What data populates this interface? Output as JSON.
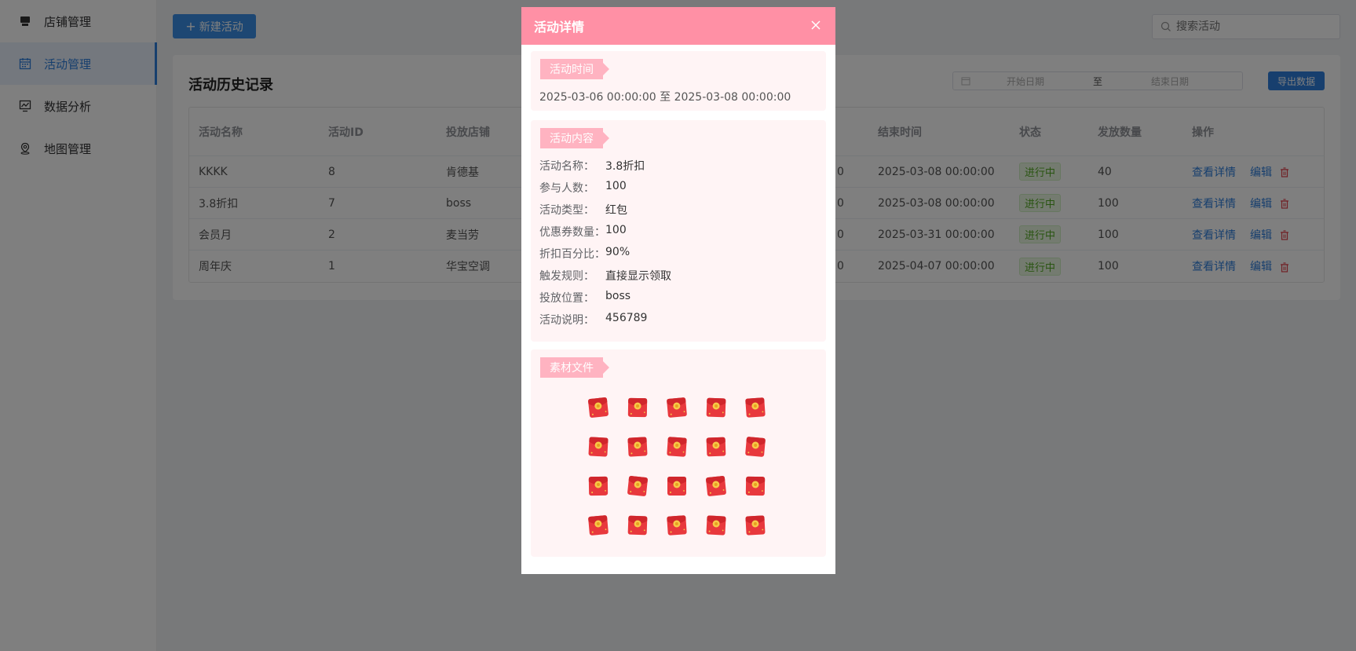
{
  "sidebar": {
    "items": [
      {
        "label": "店铺管理",
        "icon": "shop-icon"
      },
      {
        "label": "活动管理",
        "icon": "calendar-icon",
        "active": true
      },
      {
        "label": "数据分析",
        "icon": "chart-icon"
      },
      {
        "label": "地图管理",
        "icon": "map-pin-icon"
      }
    ]
  },
  "toolbar": {
    "new_label": "新建活动",
    "search_placeholder": "搜索活动"
  },
  "history": {
    "title": "活动历史记录",
    "range_start": "开始日期",
    "range_sep": "至",
    "range_end": "结束日期",
    "export_label": "导出数据"
  },
  "table": {
    "headers": [
      "活动名称",
      "活动ID",
      "投放店铺",
      "结束时间",
      "状态",
      "发放数量",
      "操作"
    ],
    "rows": [
      {
        "name": "KKKK",
        "id": "8",
        "shop": "肯德基",
        "clip": "0",
        "end": "2025-03-08 00:00:00",
        "status": "进行中",
        "qty": "40"
      },
      {
        "name": "3.8折扣",
        "id": "7",
        "shop": "boss",
        "clip": "0",
        "end": "2025-03-08 00:00:00",
        "status": "进行中",
        "qty": "100"
      },
      {
        "name": "会员月",
        "id": "2",
        "shop": "麦当劳",
        "clip": "0",
        "end": "2025-03-31 00:00:00",
        "status": "进行中",
        "qty": "100"
      },
      {
        "name": "周年庆",
        "id": "1",
        "shop": "华宝空调",
        "clip": "0",
        "end": "2025-04-07 00:00:00",
        "status": "进行中",
        "qty": "100"
      }
    ],
    "action_detail": "查看详情",
    "action_edit": "编辑"
  },
  "modal": {
    "title": "活动详情",
    "time_tag": "活动时间",
    "time_text": "2025-03-06 00:00:00 至 2025-03-08 00:00:00",
    "content_tag": "活动内容",
    "fields": [
      {
        "k": "活动名称：",
        "v": "3.8折扣"
      },
      {
        "k": "参与人数：",
        "v": "100"
      },
      {
        "k": "活动类型：",
        "v": "红包"
      },
      {
        "k": "优惠券数量：",
        "v": "100"
      },
      {
        "k": "折扣百分比：",
        "v": "90%"
      },
      {
        "k": "触发规则：",
        "v": "直接显示领取"
      },
      {
        "k": "投放位置：",
        "v": "boss"
      },
      {
        "k": "活动说明：",
        "v": "456789"
      }
    ],
    "material_tag": "素材文件",
    "material_icon": "red-envelope-icon",
    "material_count": 20
  },
  "colors": {
    "primary": "#2f7fdc",
    "modal_header": "#ff90a5",
    "tag": "#ffb3c1",
    "section_bg": "#fff4f5",
    "status_green": "#52a822",
    "danger": "#e0414a"
  }
}
